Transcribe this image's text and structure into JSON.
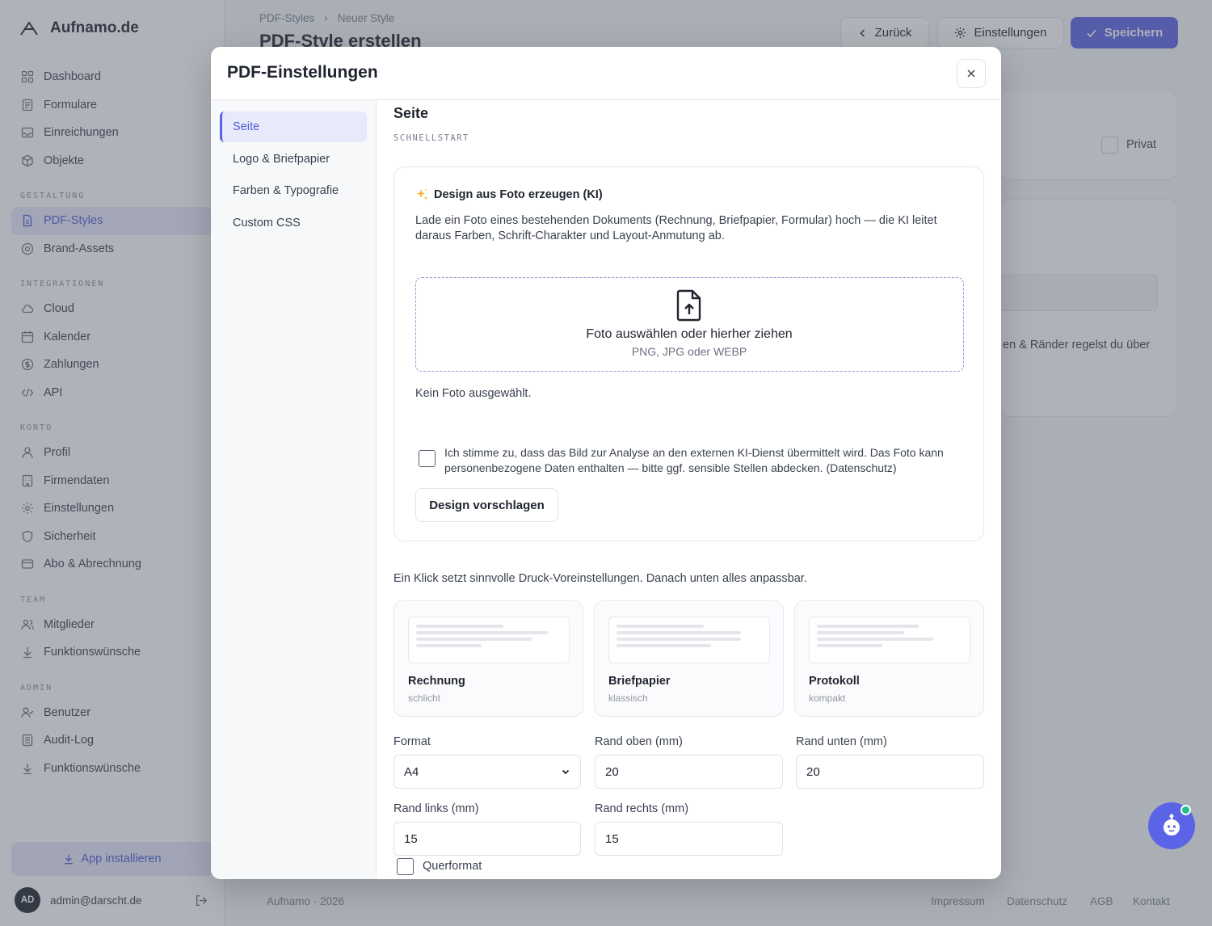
{
  "app": {
    "name": "Aufnamo.de"
  },
  "sidebar": {
    "main_items": [
      {
        "label": "Dashboard",
        "icon": "grid-icon"
      },
      {
        "label": "Formulare",
        "icon": "form-icon"
      },
      {
        "label": "Einreichungen",
        "icon": "inbox-icon"
      },
      {
        "label": "Objekte",
        "icon": "cube-icon"
      }
    ],
    "sections": {
      "gestaltung": "GESTALTUNG",
      "integrationen": "INTEGRATIONEN",
      "konto": "KONTO",
      "team": "TEAM",
      "admin": "ADMIN"
    },
    "gestaltung_items": [
      {
        "label": "PDF-Styles",
        "icon": "document-icon",
        "active": true
      },
      {
        "label": "Brand-Assets",
        "icon": "target-icon"
      }
    ],
    "integration_items": [
      {
        "label": "Cloud",
        "icon": "cloud-icon"
      },
      {
        "label": "Kalender",
        "icon": "calendar-icon"
      },
      {
        "label": "Zahlungen",
        "icon": "dollar-icon"
      },
      {
        "label": "API",
        "icon": "code-icon"
      }
    ],
    "konto_items": [
      {
        "label": "Profil",
        "icon": "user-icon"
      },
      {
        "label": "Firmendaten",
        "icon": "building-icon"
      },
      {
        "label": "Einstellungen",
        "icon": "gear-icon"
      },
      {
        "label": "Sicherheit",
        "icon": "shield-icon"
      },
      {
        "label": "Abo & Abrechnung",
        "icon": "credit-card-icon"
      }
    ],
    "team_items": [
      {
        "label": "Mitglieder",
        "icon": "users-icon"
      },
      {
        "label": "Funktionswünsche",
        "icon": "arrow-down-icon"
      }
    ],
    "admin_items": [
      {
        "label": "Benutzer",
        "icon": "user-check-icon"
      },
      {
        "label": "Audit-Log",
        "icon": "log-icon"
      },
      {
        "label": "Funktionswünsche",
        "icon": "arrow-down-icon"
      }
    ],
    "install_label": "App installieren",
    "user": {
      "initials": "AD",
      "email": "admin@darscht.de"
    }
  },
  "header": {
    "breadcrumb": [
      "PDF-Styles",
      "Neuer Style"
    ],
    "title": "PDF-Style erstellen",
    "back_label": "Zurück",
    "settings_label": "Einstellungen",
    "save_label": "Speichern"
  },
  "background": {
    "private_label": "Privat",
    "partial_text": "en & Ränder regelst du über"
  },
  "footer": {
    "copyright": "Aufnamo · 2026",
    "links": [
      "Impressum",
      "Datenschutz",
      "AGB",
      "Kontakt"
    ]
  },
  "modal": {
    "title": "PDF-Einstellungen",
    "nav": [
      "Seite",
      "Logo & Briefpapier",
      "Farben & Typografie",
      "Custom CSS"
    ],
    "section_title": "Seite",
    "section_subtitle": "SCHNELLSTART",
    "ai": {
      "title": "Design aus Foto erzeugen (KI)",
      "description": "Lade ein Foto eines bestehenden Dokuments (Rechnung, Briefpapier, Formular) hoch — die KI leitet daraus Farben, Schrift-Charakter und Layout-Anmutung ab.",
      "dropzone_main": "Foto auswählen oder hierher ziehen",
      "dropzone_sub": "PNG, JPG oder WEBP",
      "no_photo": "Kein Foto ausgewählt.",
      "consent": "Ich stimme zu, dass das Bild zur Analyse an den externen KI-Dienst übermittelt wird. Das Foto kann personenbezogene Daten enthalten — bitte ggf. sensible Stellen abdecken. (Datenschutz)",
      "suggest_label": "Design vorschlagen"
    },
    "presets_hint": "Ein Klick setzt sinnvolle Druck-Voreinstellungen. Danach unten alles anpassbar.",
    "presets": [
      {
        "name": "Rechnung",
        "sub": "schlicht"
      },
      {
        "name": "Briefpapier",
        "sub": "klassisch"
      },
      {
        "name": "Protokoll",
        "sub": "kompakt"
      }
    ],
    "fields": {
      "format_label": "Format",
      "format_value": "A4",
      "margin_top_label": "Rand oben (mm)",
      "margin_top_value": "20",
      "margin_bottom_label": "Rand unten (mm)",
      "margin_bottom_value": "20",
      "margin_left_label": "Rand links (mm)",
      "margin_left_value": "15",
      "margin_right_label": "Rand rechts (mm)",
      "margin_right_value": "15",
      "landscape_label": "Querformat"
    }
  },
  "colors": {
    "accent": "#5b63e6",
    "status_online": "#22c08a"
  }
}
